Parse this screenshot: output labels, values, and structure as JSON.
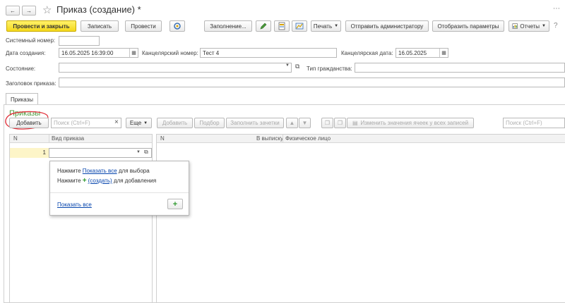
{
  "window": {
    "title": "Приказ (создание) *",
    "nav_back": "←",
    "nav_forward": "→",
    "star": "☆"
  },
  "toolbar": {
    "post_close": "Провести и закрыть",
    "save": "Записать",
    "post": "Провести",
    "fill": "Заполнение...",
    "print": "Печать",
    "send_admin": "Отправить администратору",
    "show_params": "Отобразить параметры",
    "reports": "Отчеты",
    "more_symbol": "⋯"
  },
  "form": {
    "system_number_label": "Системный номер:",
    "system_number_value": "",
    "created_label": "Дата создания:",
    "created_value": "16.05.2025 16:39:00",
    "office_number_label": "Канцелярский номер:",
    "office_number_value": "Тест 4",
    "office_date_label": "Канцелярская дата:",
    "office_date_value": "16.05.2025",
    "state_label": "Состояние:",
    "state_value": "",
    "citizenship_label": "Тип гражданства:",
    "citizenship_value": "",
    "header_label": "Заголовок приказа:",
    "header_value": ""
  },
  "tabs": [
    {
      "label": "Приказы"
    }
  ],
  "section": {
    "title": "Приказы"
  },
  "left_panel": {
    "add": "Добавить",
    "search_placeholder": "Поиск (Ctrl+F)",
    "clear": "×",
    "more": "Еще",
    "columns": [
      "N",
      "Вид приказа"
    ],
    "rows": [
      {
        "n": "1",
        "kind": ""
      }
    ]
  },
  "right_panel": {
    "add": "Добавить",
    "pick": "Подбор",
    "fill_credits": "Заполнить зачетки",
    "change_cells": "Изменить значения ячеек у всех записей",
    "search_placeholder": "Поиск (Ctrl+F)",
    "columns": [
      "N",
      "В выписку",
      "Физическое лицо"
    ]
  },
  "dropdown": {
    "line1_prefix": "Нажмите ",
    "line1_link": "Показать все",
    "line1_suffix": " для выбора",
    "line2_prefix": "Нажмите ",
    "line2_link": "(создать)",
    "line2_suffix": " для добавления",
    "show_all": "Показать все",
    "plus": "+"
  },
  "colors": {
    "accent_yellow": "#f4d81c",
    "annotation_red": "#e0303a",
    "link_blue": "#0645ad",
    "section_green": "#4a9a3a",
    "row_highlight": "#fdf5c8"
  }
}
